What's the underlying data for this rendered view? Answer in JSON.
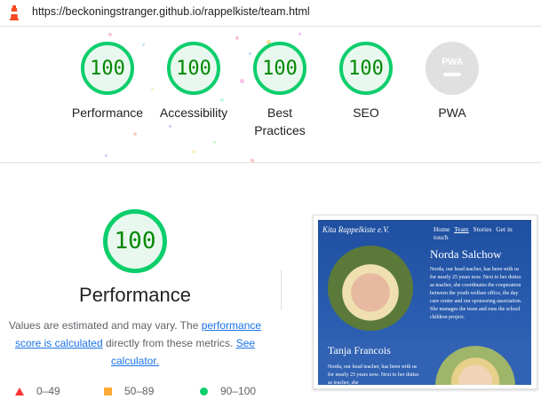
{
  "browser": {
    "url": "https://beckoningstranger.github.io/rappelkiste/team.html"
  },
  "gauges": [
    {
      "score": "100",
      "label": "Performance"
    },
    {
      "score": "100",
      "label": "Accessibility"
    },
    {
      "score": "100",
      "label": "Best Practices"
    },
    {
      "score": "100",
      "label": "SEO"
    },
    {
      "badge": "PWA",
      "label": "PWA"
    }
  ],
  "performance": {
    "score": "100",
    "title": "Performance",
    "desc_prefix": "Values are estimated and may vary. The ",
    "desc_link1": "performance score is calculated",
    "desc_middle": " directly from these metrics. ",
    "desc_link2": "See calculator."
  },
  "legend": [
    {
      "range": "0–49",
      "color": "#ff3333"
    },
    {
      "range": "50–89",
      "color": "#ffaa33"
    },
    {
      "range": "90–100",
      "color": "#0cce6b"
    }
  ],
  "screenshot": {
    "brand": "Kita Rappelkiste e.V.",
    "nav": [
      "Home",
      "Team",
      "Stories",
      "Get in touch"
    ],
    "person1": {
      "name": "Norda Salchow",
      "text": "Norda, our head teacher, has been with us for nearly 25 years now. Next to her duties as teacher, she coordinates the cooperation between the youth welfare office, the day care center and our sponsoring association. She manages the team and runs the school children project."
    },
    "person2": {
      "name": "Tanja Francois",
      "text": "Norda, our head teacher, has been with us for nearly 25 years now. Next to her duties as teacher, she"
    }
  },
  "colors": {
    "pass": "#0cce6b",
    "pass_text": "#008800",
    "link": "#1a73e8"
  }
}
